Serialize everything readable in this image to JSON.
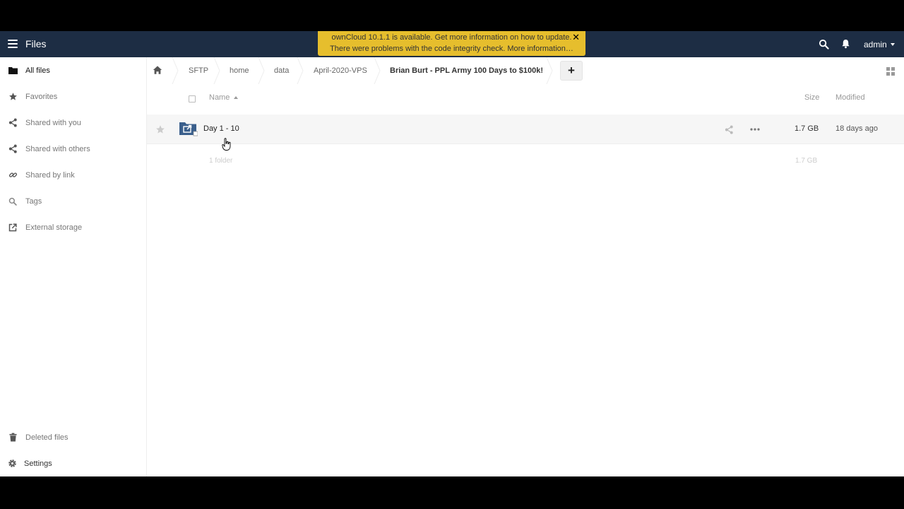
{
  "header": {
    "app_title": "Files",
    "user": "admin",
    "icons": [
      "menu-icon",
      "search-icon",
      "bell-icon",
      "caret-down-icon"
    ]
  },
  "notification": {
    "line1": "ownCloud 10.1.1 is available. Get more information on how to update.",
    "line2": "There were problems with the code integrity check. More information…",
    "close": "✕",
    "color": "#e6be2d"
  },
  "sidebar": {
    "items": [
      {
        "label": "All files",
        "icon": "folder-icon",
        "active": true
      },
      {
        "label": "Favorites",
        "icon": "star-icon"
      },
      {
        "label": "Shared with you",
        "icon": "share-icon"
      },
      {
        "label": "Shared with others",
        "icon": "share-icon"
      },
      {
        "label": "Shared by link",
        "icon": "link-icon"
      },
      {
        "label": "Tags",
        "icon": "search-icon"
      },
      {
        "label": "External storage",
        "icon": "external-icon"
      }
    ],
    "bottom": [
      {
        "label": "Deleted files",
        "icon": "trash-icon"
      },
      {
        "label": "Settings",
        "icon": "gear-icon"
      }
    ]
  },
  "breadcrumb": [
    "SFTP",
    "home",
    "data",
    "April-2020-VPS",
    "Brian Burt - PPL Army 100 Days to $100k!"
  ],
  "new_button": "+",
  "table": {
    "columns": {
      "name": "Name",
      "size": "Size",
      "modified": "Modified"
    },
    "rows": [
      {
        "name": "Day 1 - 10",
        "size": "1.7 GB",
        "modified": "18 days ago",
        "type": "shared-folder"
      }
    ],
    "summary": {
      "count": "1 folder",
      "size": "1.7 GB"
    }
  },
  "colors": {
    "header": "#1d2d44",
    "folder": "#3a5f8c"
  }
}
